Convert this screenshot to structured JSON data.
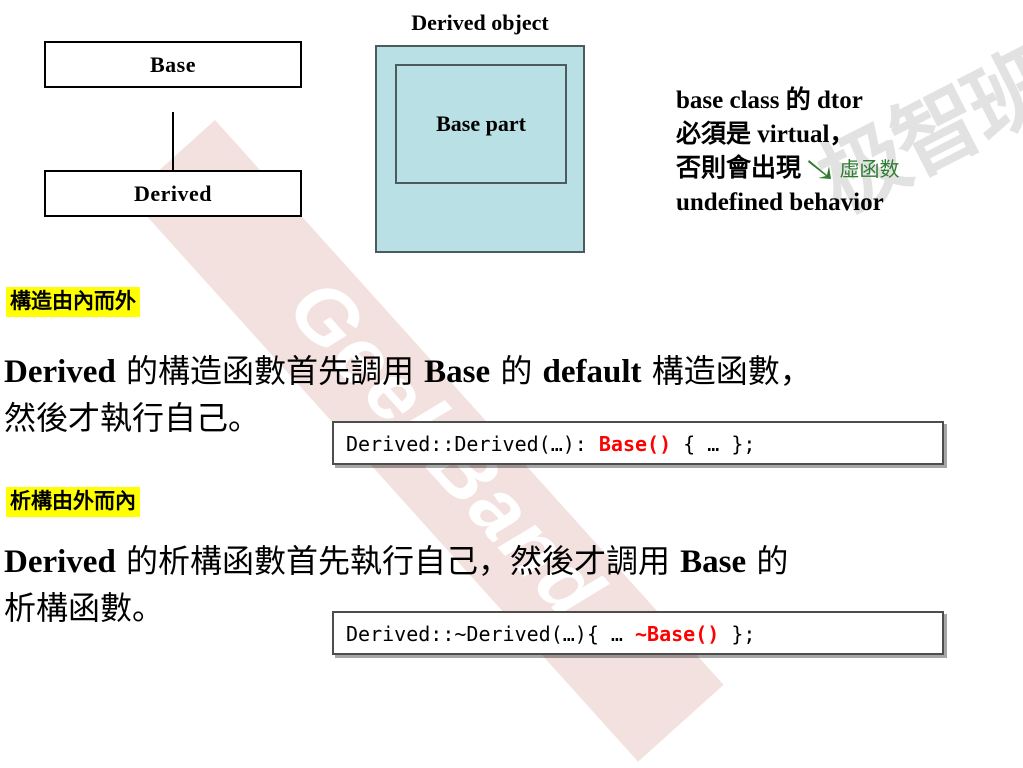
{
  "uml": {
    "base_label": "Base",
    "derived_label": "Derived",
    "arrow_icon": "hollow-triangle-inheritance-arrow"
  },
  "object_layout": {
    "title": "Derived object",
    "base_part_label": "Base part",
    "fill_color": "#b9e0e4",
    "border_color": "#4b5b5e"
  },
  "note": {
    "line1": "base class 的 dtor",
    "line2": "必須是 virtual，",
    "line3_prefix": "否則會出現",
    "annotation": "虛函数",
    "annotation_color": "#2f7d31",
    "arrow_icon": "green-arrow-down-right",
    "line4": "undefined behavior"
  },
  "sections": [
    {
      "label": "構造由內而外",
      "label_bg": "#ffff00",
      "text_line1_a": "Derived",
      "text_line1_b": " 的構造函數首先調用 ",
      "text_line1_c": "Base",
      "text_line1_d": " 的 ",
      "text_line1_e": "default",
      "text_line1_f": " 構造函數，",
      "text_line2": "然後才執行自己。",
      "code_prefix": "Derived::Derived(…): ",
      "code_keyword": "Base()",
      "code_suffix": " { … };"
    },
    {
      "label": "析構由外而內",
      "label_bg": "#ffff00",
      "text_line1_a": "Derived",
      "text_line1_b": " 的析構函數首先執行自己，然後才調用 ",
      "text_line1_c": "Base",
      "text_line1_d": " 的",
      "text_line2": "析構函數。",
      "code_prefix": "Derived::~Derived(…){ … ",
      "code_keyword": "~Base()",
      "code_suffix": " };"
    }
  ],
  "watermarks": {
    "brand": "GeekBand",
    "brand_band_color": "#f0dcd8",
    "cn_text": "极智班",
    "cn_color": "#e2e2e2"
  }
}
